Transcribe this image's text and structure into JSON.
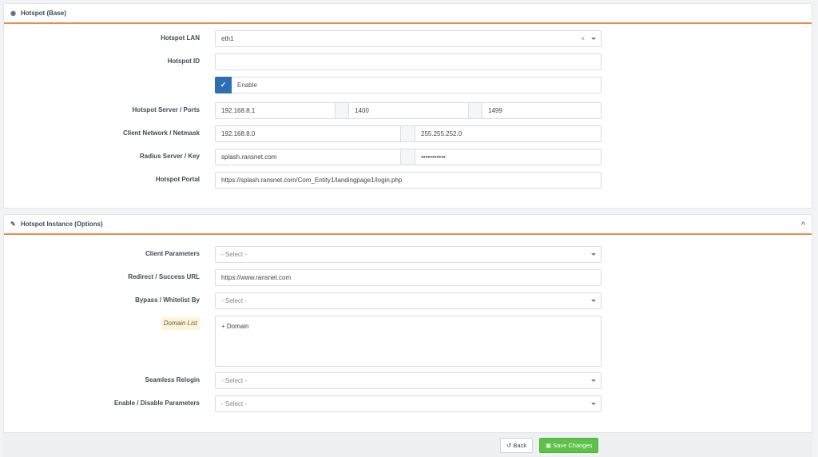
{
  "base": {
    "title": "Hotspot (Base)",
    "lan_label": "Hotspot LAN",
    "lan_value": "eth1",
    "clear": "×",
    "id_label": "Hotspot ID",
    "id_value": "",
    "enable_label": "Enable",
    "checkmark": "✓",
    "server_label": "Hotspot Server / Ports",
    "server_ip": "192.168.8.1",
    "port1": "1400",
    "port2": "1499",
    "network_label": "Client Network / Netmask",
    "network": "192.168.8.0",
    "netmask": "255.255.252.0",
    "radius_label": "Radius Server / Key",
    "radius_server": "splash.ransnet.com",
    "radius_key": "•••••••••••",
    "portal_label": "Hotspot Portal",
    "portal_url": "https://splash.ransnet.com/Com_Entity1/landingpage1/login.php"
  },
  "instance": {
    "title": "Hotspot Instance (Options)",
    "collapse": "^",
    "client_params_label": "Client Parameters",
    "select_placeholder": "- Select -",
    "redirect_label": "Redirect / Success URL",
    "redirect_url": "https://www.ransnet.com",
    "bypass_label": "Bypass / Whitelist By",
    "domain_list_label": "Domain List",
    "add_domain": "+ Domain",
    "seamless_label": "Seamless Relogin",
    "enable_disable_label": "Enable / Disable Parameters"
  },
  "footer": {
    "back": "Back",
    "save": "Save Changes",
    "back_icon": "↺",
    "save_icon": "▣"
  }
}
